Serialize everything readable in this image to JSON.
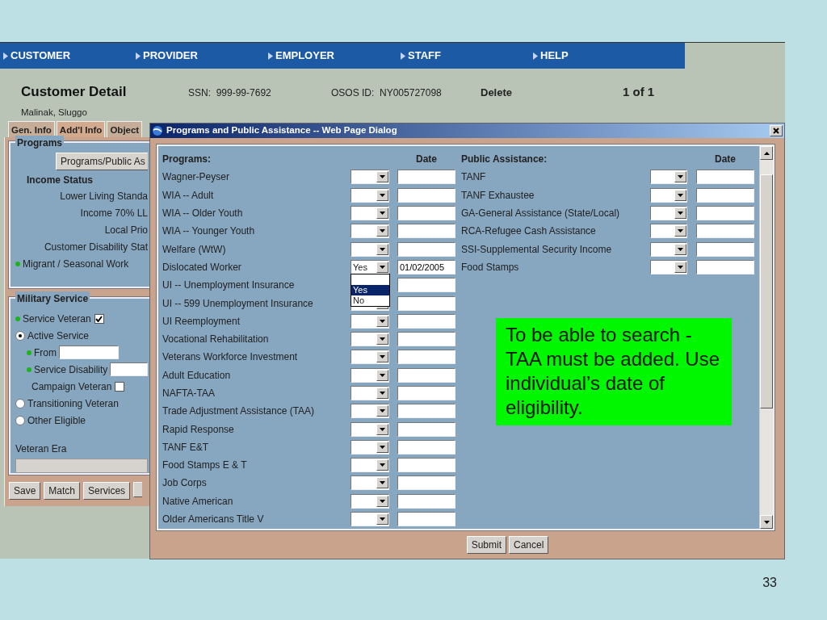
{
  "nav": [
    {
      "label": "CUSTOMER"
    },
    {
      "label": "PROVIDER"
    },
    {
      "label": "EMPLOYER"
    },
    {
      "label": "STAFF"
    },
    {
      "label": "HELP"
    }
  ],
  "header": {
    "title": "Customer Detail",
    "customer_name": "Malinak, Sluggo",
    "ssn": "SSN:  999-99-7692",
    "osos_id": "OSOS ID:  NY005727098",
    "delete": "Delete",
    "pager": "1 of 1"
  },
  "tabs": [
    {
      "label": "Gen. Info",
      "selected": false
    },
    {
      "label": "Add'l Info",
      "selected": true
    },
    {
      "label": "Object",
      "selected": false
    }
  ],
  "programs_panel": {
    "legend": "Programs",
    "button": "Programs/Public As",
    "heading": "Income Status",
    "rows": [
      {
        "label": "Lower Living Standa",
        "flag": false
      },
      {
        "label": "Income 70% LL",
        "flag": false
      },
      {
        "label": "Local Prio",
        "flag": false
      },
      {
        "label": "Customer Disability Stat",
        "flag": false
      },
      {
        "label": "Migrant / Seasonal Work",
        "flag": true
      }
    ]
  },
  "military_panel": {
    "legend": "Military Service",
    "items": [
      {
        "kind": "checkbox",
        "label": "Service Veteran",
        "flag": true,
        "checked": true
      },
      {
        "kind": "radio",
        "label": "Active Service",
        "flag": false,
        "selected": true,
        "children": [
          {
            "kind": "field",
            "label": "From",
            "flag": true
          },
          {
            "kind": "field",
            "label": "Service Disability",
            "flag": true
          },
          {
            "kind": "checkbox",
            "label": "Campaign Veteran",
            "flag": false,
            "checked": false
          }
        ]
      },
      {
        "kind": "radio",
        "label": "Transitioning Veteran",
        "flag": false,
        "selected": false
      },
      {
        "kind": "radio",
        "label": "Other Eligible",
        "flag": false,
        "selected": false
      }
    ],
    "era_label": "Veteran Era"
  },
  "buttons": [
    "Save",
    "Match",
    "Services"
  ],
  "dialog": {
    "title": "Programs and Public Assistance -- Web Page Dialog",
    "programs_heading": "Programs:",
    "programs_date_heading": "Date",
    "programs": [
      {
        "label": "Wagner-Peyser"
      },
      {
        "label": "WIA -- Adult"
      },
      {
        "label": "WIA -- Older Youth"
      },
      {
        "label": "WIA -- Younger Youth"
      },
      {
        "label": "Welfare (WtW)"
      },
      {
        "label": "Dislocated Worker",
        "value": "Yes",
        "date": "01/02/2005",
        "options": [
          {
            "label": "Yes",
            "selected": true
          },
          {
            "label": "No",
            "selected": false
          }
        ]
      },
      {
        "label": "UI -- Unemployment Insurance"
      },
      {
        "label": "UI -- 599 Unemployment Insurance"
      },
      {
        "label": "UI Reemployment"
      },
      {
        "label": "Vocational Rehabilitation"
      },
      {
        "label": "Veterans Workforce Investment"
      },
      {
        "label": "Adult Education"
      },
      {
        "label": "NAFTA-TAA"
      },
      {
        "label": "Trade Adjustment Assistance (TAA)"
      },
      {
        "label": "Rapid Response"
      },
      {
        "label": "TANF E&T"
      },
      {
        "label": "Food Stamps E & T"
      },
      {
        "label": "Job Corps"
      },
      {
        "label": "Native American"
      },
      {
        "label": "Older Americans Title V"
      }
    ],
    "public_heading": "Public Assistance:",
    "public_date_heading": "Date",
    "public": [
      {
        "label": "TANF"
      },
      {
        "label": "TANF Exhaustee"
      },
      {
        "label": "GA-General Assistance (State/Local)"
      },
      {
        "label": "RCA-Refugee Cash Assistance"
      },
      {
        "label": "SSI-Supplemental Security Income"
      },
      {
        "label": "Food Stamps"
      }
    ],
    "buttons": [
      "Submit",
      "Cancel"
    ]
  },
  "note": "To be able to search - TAA must be added. Use individual’s date of eligibility.",
  "slide_number": "33"
}
